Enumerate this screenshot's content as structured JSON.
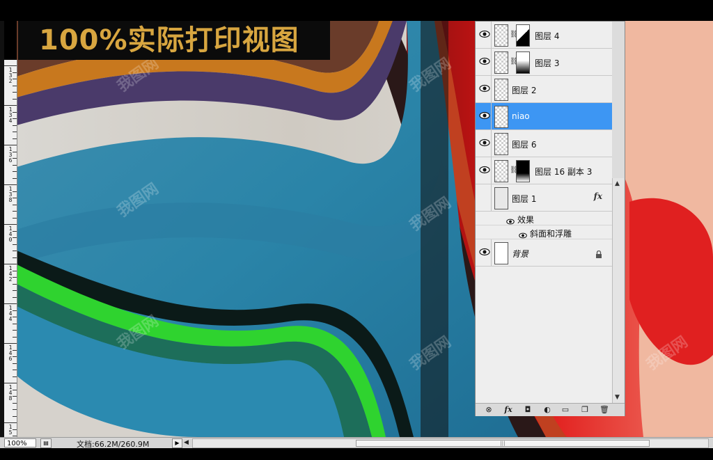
{
  "title_banner": {
    "text": "100%实际打印视图"
  },
  "watermark": {
    "text": "我图网"
  },
  "ruler": {
    "labels": [
      "1\n3\n2",
      "1\n3\n4",
      "1\n3\n6",
      "1\n3\n8",
      "1\n4\n0",
      "1\n4\n2",
      "1\n4\n4",
      "1\n4\n6",
      "1\n4\n8",
      "1\n5"
    ]
  },
  "layers_panel": {
    "layers": [
      {
        "name": "图层 4",
        "visible": true,
        "selected": false,
        "has_mask": true,
        "has_fx": false,
        "locked": false
      },
      {
        "name": "图层 3",
        "visible": true,
        "selected": false,
        "has_mask": true,
        "has_fx": false,
        "locked": false
      },
      {
        "name": "图层 2",
        "visible": true,
        "selected": false,
        "has_mask": false,
        "has_fx": false,
        "locked": false
      },
      {
        "name": "niao",
        "visible": true,
        "selected": true,
        "has_mask": false,
        "has_fx": false,
        "locked": false
      },
      {
        "name": "图层 6",
        "visible": true,
        "selected": false,
        "has_mask": false,
        "has_fx": false,
        "locked": false
      },
      {
        "name": "图层 16 副本 3",
        "visible": true,
        "selected": false,
        "has_mask": true,
        "has_fx": false,
        "locked": false
      },
      {
        "name": "图层 1",
        "visible": false,
        "selected": false,
        "has_mask": false,
        "has_fx": true,
        "locked": false
      },
      {
        "name": "背景",
        "visible": true,
        "selected": false,
        "has_mask": false,
        "has_fx": false,
        "locked": true
      }
    ],
    "effects": {
      "label": "效果",
      "items": [
        "斜面和浮雕"
      ]
    },
    "fx_symbol": "fx",
    "footer_icons": [
      "link-icon",
      "fx-icon",
      "mask-icon",
      "adjustment-icon",
      "folder-icon",
      "new-layer-icon",
      "trash-icon"
    ]
  },
  "status_bar": {
    "zoom": "100%",
    "doc_info": "文档:66.2M/260.9M"
  },
  "colors": {
    "selected_layer": "#3d96f3",
    "title_text": "#d8a640"
  }
}
